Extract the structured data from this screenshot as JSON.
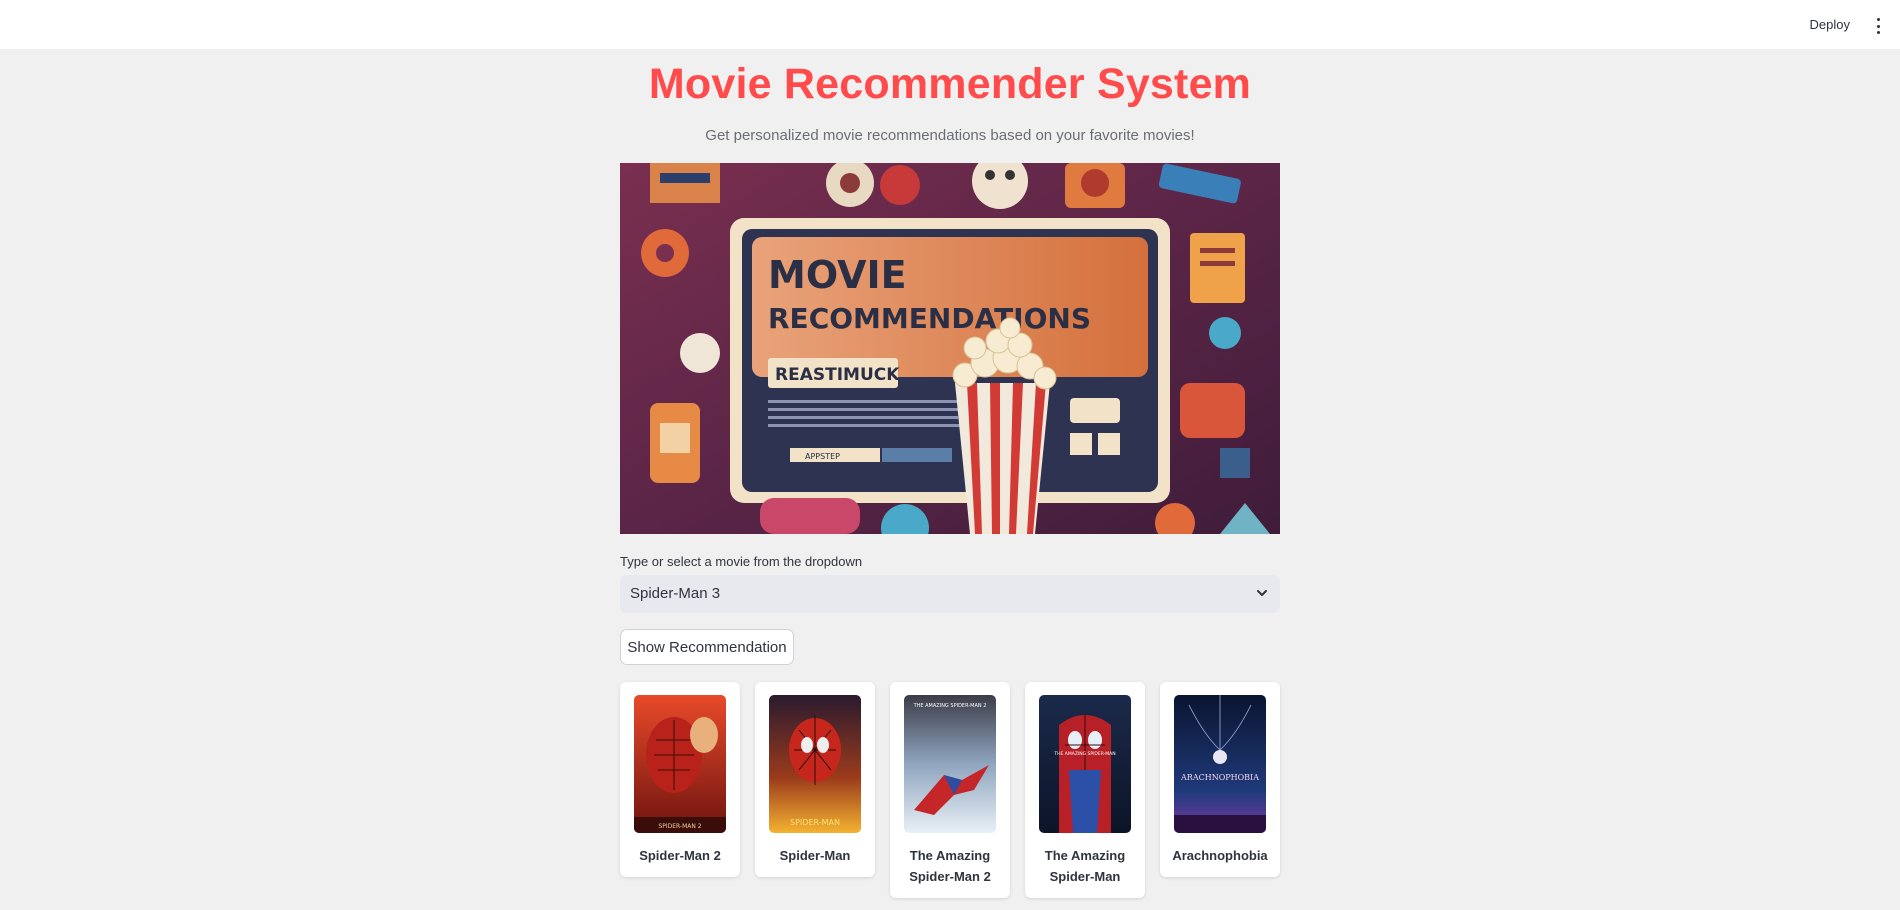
{
  "header": {
    "deploy_label": "Deploy",
    "menu_icon": "kebab-menu-icon"
  },
  "page": {
    "title": "Movie Recommender System",
    "subtitle": "Get personalized movie recommendations based on your favorite movies!"
  },
  "hero": {
    "screen_line1": "MOVIE",
    "screen_line2": "RECOMMENDATIONS",
    "screen_tag": "REASTIMUCK",
    "screen_button": "APPSTEP"
  },
  "select": {
    "label": "Type or select a movie from the dropdown",
    "value": "Spider-Man 3"
  },
  "actions": {
    "show_label": "Show Recommendation"
  },
  "recommendations": [
    {
      "title": "Spider-Man 2",
      "poster_text": "SPIDER-MAN 2"
    },
    {
      "title": "Spider-Man",
      "poster_text": "SPIDER-MAN"
    },
    {
      "title": "The Amazing Spider-Man 2",
      "poster_text": "THE AMAZING SPIDER-MAN 2"
    },
    {
      "title": "The Amazing Spider-Man",
      "poster_text": "THE AMAZING SPIDER-MAN"
    },
    {
      "title": "Arachnophobia",
      "poster_text": "ARACHNOPHOBIA"
    }
  ],
  "colors": {
    "accent": "#ff4b4b",
    "background": "#f0f0f0",
    "text": "#31333f"
  }
}
